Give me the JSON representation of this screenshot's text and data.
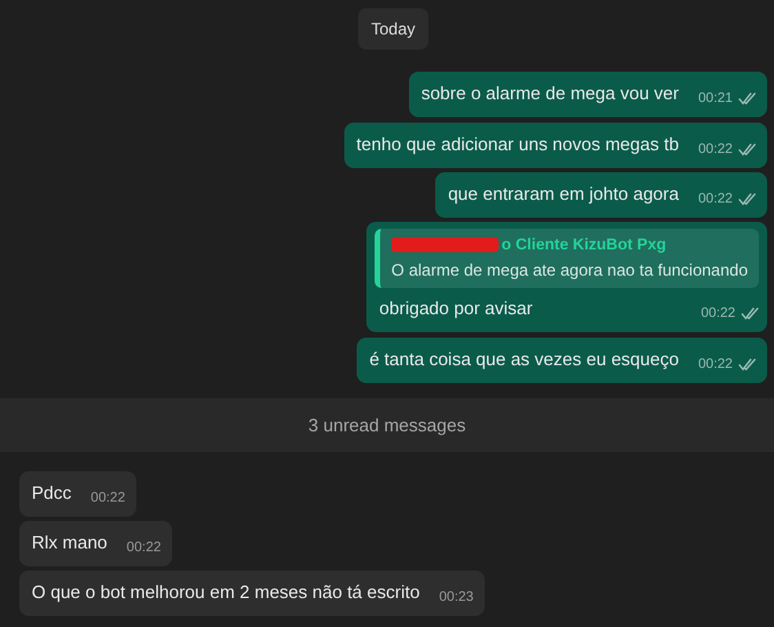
{
  "date_pill": "Today",
  "timeline": [
    {
      "kind": "out",
      "text": "sobre o alarme de mega vou ver",
      "time": "00:21",
      "read": false
    },
    {
      "kind": "out",
      "text": "tenho que adicionar uns novos megas tb",
      "time": "00:22",
      "read": false
    },
    {
      "kind": "out",
      "text": "que entraram em johto agora",
      "time": "00:22",
      "read": false
    },
    {
      "kind": "out",
      "quote": {
        "author": "o Cliente KizuBot Pxg",
        "redacted": true,
        "text": "O alarme de mega ate agora nao ta funcionando"
      },
      "text": "obrigado por avisar",
      "time": "00:22",
      "read": false
    },
    {
      "kind": "out",
      "text": "é tanta coisa que as vezes eu esqueço",
      "time": "00:22",
      "read": false
    },
    {
      "kind": "divider",
      "text": "3 unread messages"
    },
    {
      "kind": "in",
      "text": "Pdcc",
      "time": "00:22"
    },
    {
      "kind": "in",
      "text": "Rlx mano",
      "time": "00:22"
    },
    {
      "kind": "in",
      "text": "O que o bot melhorou em 2 meses não tá escrito",
      "time": "00:23"
    }
  ]
}
